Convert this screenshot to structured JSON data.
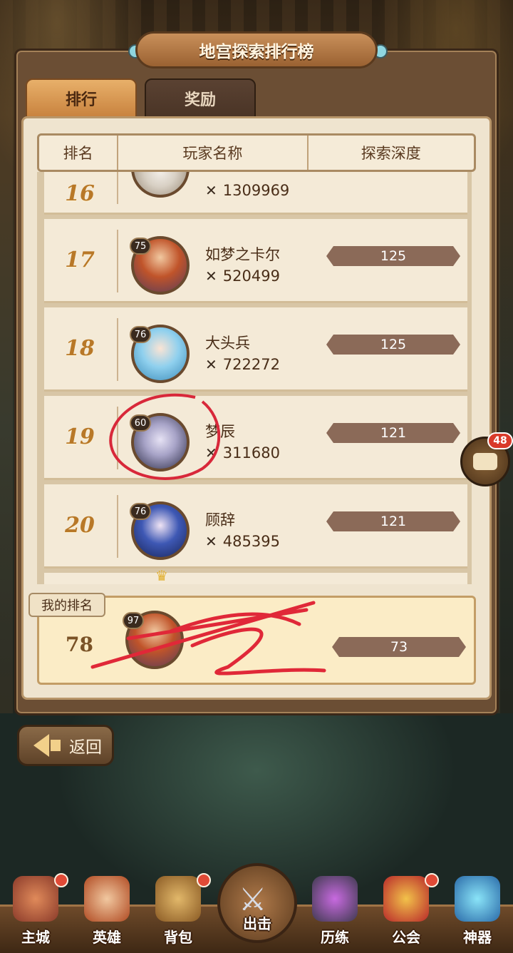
{
  "title": "地宫探索排行榜",
  "tabs": [
    {
      "label": "排行",
      "active": true
    },
    {
      "label": "奖励",
      "active": false
    }
  ],
  "columns": [
    "排名",
    "玩家名称",
    "探索深度"
  ],
  "rows": [
    {
      "rank": "16",
      "level": "",
      "name": "",
      "power": "1309969",
      "depth": ""
    },
    {
      "rank": "17",
      "level": "75",
      "name": "如梦之卡尔",
      "power": "520499",
      "depth": "125"
    },
    {
      "rank": "18",
      "level": "76",
      "name": "大头兵",
      "power": "722272",
      "depth": "125"
    },
    {
      "rank": "19",
      "level": "60",
      "name": "梦辰",
      "power": "311680",
      "depth": "121"
    },
    {
      "rank": "20",
      "level": "76",
      "name": "顾辞",
      "power": "485395",
      "depth": "121"
    }
  ],
  "my_rank": {
    "tag": "我的排名",
    "rank": "78",
    "level": "97",
    "depth": "73"
  },
  "back_label": "返回",
  "chat_badge": "48",
  "nav": [
    {
      "label": "主城",
      "icon": "castle-icon",
      "dot": true
    },
    {
      "label": "英雄",
      "icon": "hero-icon",
      "dot": false
    },
    {
      "label": "背包",
      "icon": "backpack-icon",
      "dot": true
    },
    {
      "label": "出击",
      "icon": "crossed-swords-icon",
      "dot": false
    },
    {
      "label": "历练",
      "icon": "trial-gate-icon",
      "dot": false
    },
    {
      "label": "公会",
      "icon": "guild-shield-icon",
      "dot": true
    },
    {
      "label": "神器",
      "icon": "artifact-crystal-icon",
      "dot": false
    }
  ],
  "colors": {
    "panel": "#6b4e34",
    "rank_gold": "#b87828",
    "depth_bar": "#8b6a58",
    "badge_red": "#d93a2a"
  }
}
